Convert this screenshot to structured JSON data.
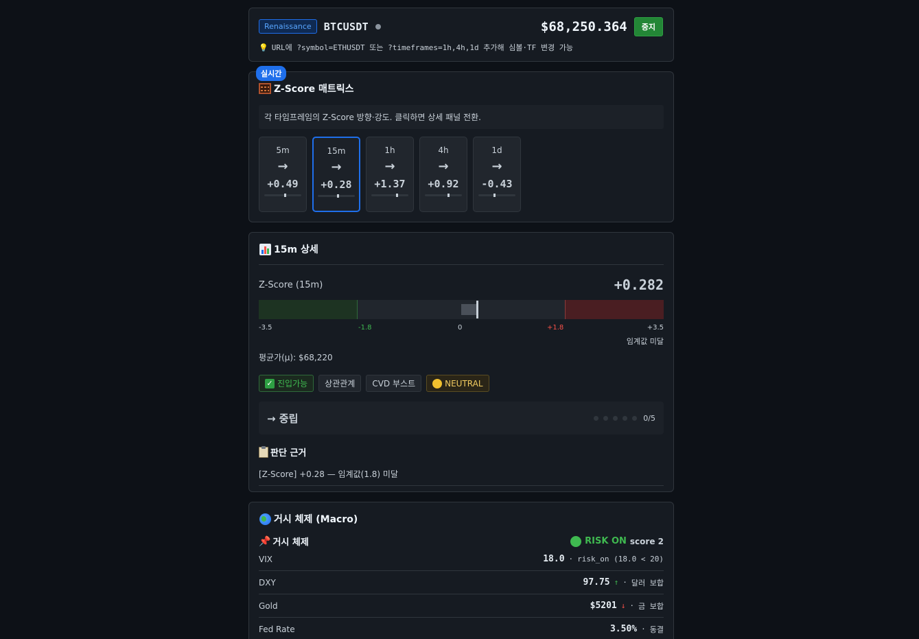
{
  "header": {
    "strategy": "Renaissance",
    "symbol": "BTCUSDT",
    "price": "$68,250.364",
    "stop_label": "중지",
    "hint": "URL에 ?symbol=ETHUSDT 또는 ?timeframes=1h,4h,1d 추가해 심볼·TF 변경 가능"
  },
  "matrix": {
    "live_badge": "실시간",
    "title": "Z-Score 매트릭스",
    "description": "각 타임프레임의 Z-Score 방향·강도. 클릭하면 상세 패널 전환.",
    "timeframes": [
      {
        "name": "5m",
        "arrow": "→",
        "value": "+0.49",
        "z": 0.49
      },
      {
        "name": "15m",
        "arrow": "→",
        "value": "+0.28",
        "z": 0.28
      },
      {
        "name": "1h",
        "arrow": "→",
        "value": "+1.37",
        "z": 1.37
      },
      {
        "name": "4h",
        "arrow": "→",
        "value": "+0.92",
        "z": 0.92
      },
      {
        "name": "1d",
        "arrow": "→",
        "value": "-0.43",
        "z": -0.43
      }
    ],
    "selected": "15m"
  },
  "detail": {
    "title": "15m 상세",
    "z_label": "Z-Score (15m)",
    "z_value": "+0.282",
    "z": 0.282,
    "scale": {
      "min": "-3.5",
      "low": "-1.8",
      "mid": "0",
      "high": "+1.8",
      "max": "+3.5"
    },
    "threshold_note": "임계값 미달",
    "mean": "평균가(μ): $68,220",
    "tags": {
      "entry": "진입가능",
      "correlation": "상관관계",
      "cvd": "CVD 부스트",
      "state": "NEUTRAL"
    },
    "verdict": "→ 중립",
    "strength": "0/5",
    "basis_title": "판단 근거",
    "basis_item": "[Z-Score] +0.28 — 임계값(1.8) 미달"
  },
  "macro": {
    "title": "거시 체제 (Macro)",
    "sub_title": "거시 체제",
    "risk_label": "RISK ON",
    "score_label": "score 2",
    "rows": [
      {
        "name": "VIX",
        "value": "18.0",
        "trend": "",
        "note": "risk_on (18.0 < 20)"
      },
      {
        "name": "DXY",
        "value": "97.75",
        "trend": "↑",
        "note": "달러 보합"
      },
      {
        "name": "Gold",
        "value": "$5201",
        "trend": "↓",
        "note": "금 보합"
      },
      {
        "name": "Fed Rate",
        "value": "3.50%",
        "trend": "",
        "note": "동결"
      }
    ],
    "separator": "·"
  },
  "colors": {
    "accent": "#1f6feb",
    "positive": "#3fb950",
    "negative": "#f85149",
    "background": "#0d1117",
    "card": "#161b22"
  }
}
